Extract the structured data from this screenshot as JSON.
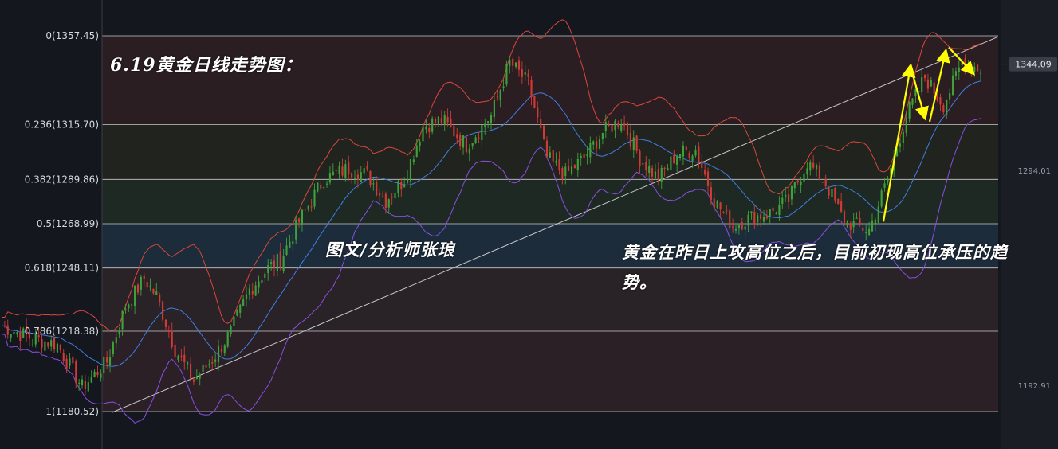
{
  "chart_data": {
    "type": "candlestick",
    "title": "6.19黄金日线走势图：",
    "author": "图文/分析师张琅",
    "comment": "黄金在昨日上攻高位之后，目前初现高位承压的趋势。",
    "fib_levels": [
      {
        "label": "0(1357.45)",
        "ratio": 0,
        "price": 1357.45,
        "color": "#2b1f24"
      },
      {
        "label": "0.236(1315.70)",
        "ratio": 0.236,
        "price": 1315.7,
        "color": "#222420"
      },
      {
        "label": "0.382(1289.86)",
        "ratio": 0.382,
        "price": 1289.86,
        "color": "#1f2a24"
      },
      {
        "label": "0.5(1268.99)",
        "ratio": 0.5,
        "price": 1268.99,
        "color": "#1d2d3c"
      },
      {
        "label": "0.618(1248.11)",
        "ratio": 0.618,
        "price": 1248.11,
        "color": "#2a2328"
      },
      {
        "label": "0.786(1218.38)",
        "ratio": 0.786,
        "price": 1218.38,
        "color": "#2b2127"
      },
      {
        "label": "1(1180.52)",
        "ratio": 1,
        "price": 1180.52,
        "color": ""
      }
    ],
    "y_axis_ticks": [
      "1294.01",
      "1192.91"
    ],
    "current_price": "1344.09",
    "colors": {
      "up": "#3fa13a",
      "down": "#d23a35",
      "upper_band": "#d9473b",
      "middle_band": "#3f7fe0",
      "lower_band": "#8a4ee0",
      "trendline": "#c8c8c8",
      "arrows": "#ffff00",
      "price_tag": "#3a3d45"
    },
    "ylim": [
      1172,
      1383
    ]
  }
}
